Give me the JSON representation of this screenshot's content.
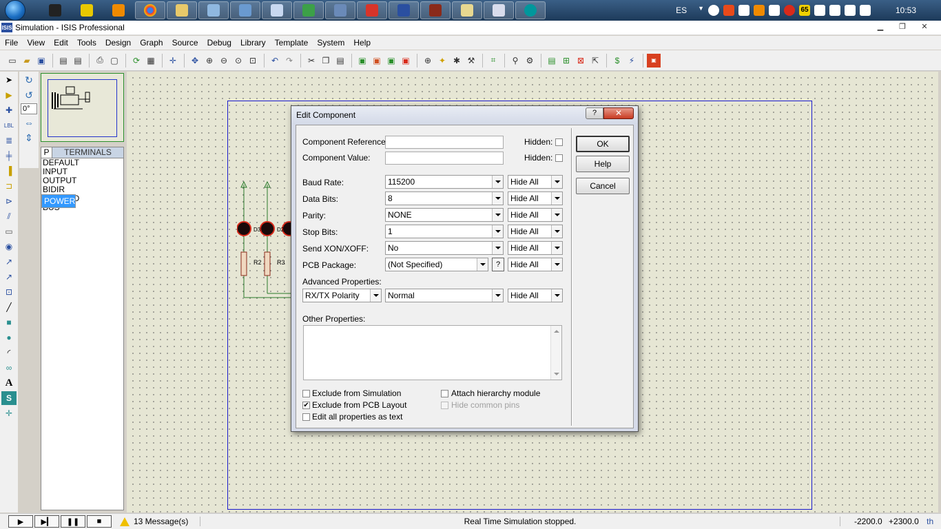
{
  "taskbar": {
    "apps": [
      {
        "name": "app-1"
      },
      {
        "name": "app-2"
      },
      {
        "name": "app-3"
      },
      {
        "name": "chrome"
      },
      {
        "name": "explorer"
      },
      {
        "name": "app-6"
      },
      {
        "name": "app-7"
      },
      {
        "name": "app-8"
      },
      {
        "name": "app-9"
      },
      {
        "name": "app-10"
      },
      {
        "name": "app-11"
      },
      {
        "name": "isis"
      },
      {
        "name": "app-13"
      },
      {
        "name": "app-14"
      },
      {
        "name": "app-15"
      },
      {
        "name": "arduino"
      }
    ],
    "language": "ES",
    "badge": "65",
    "clock": "10:53"
  },
  "window": {
    "app_icon": "ISIS",
    "title": "Simulation - ISIS Professional"
  },
  "menu": [
    "File",
    "View",
    "Edit",
    "Tools",
    "Design",
    "Graph",
    "Source",
    "Debug",
    "Library",
    "Template",
    "System",
    "Help"
  ],
  "rotation": "0°",
  "terminals": {
    "tab_p": "P",
    "header": "TERMINALS",
    "items": [
      "DEFAULT",
      "INPUT",
      "OUTPUT",
      "BIDIR",
      "POWER",
      "GROUND",
      "BUS"
    ],
    "selected": "POWER"
  },
  "dialog": {
    "title": "Edit Component",
    "help_glyph": "?",
    "close_glyph": "✕",
    "labels": {
      "component_reference": "Component Reference:",
      "component_value": "Component Value:",
      "hidden": "Hidden:",
      "baud_rate": "Baud Rate:",
      "data_bits": "Data Bits:",
      "parity": "Parity:",
      "stop_bits": "Stop Bits:",
      "send_xon": "Send XON/XOFF:",
      "pcb_package": "PCB Package:",
      "advanced": "Advanced Properties:",
      "other": "Other Properties:"
    },
    "values": {
      "component_reference": "",
      "component_value": "",
      "baud_rate": "115200",
      "data_bits": "8",
      "parity": "NONE",
      "stop_bits": "1",
      "send_xon": "No",
      "pcb_package": "(Not Specified)",
      "advanced_property": "RX/TX Polarity",
      "advanced_value": "Normal",
      "hide": "Hide All"
    },
    "checkboxes": {
      "exclude_sim": {
        "label": "Exclude from Simulation",
        "checked": false
      },
      "exclude_pcb": {
        "label": "Exclude from PCB Layout",
        "checked": true
      },
      "edit_all": {
        "label": "Edit all properties as text",
        "checked": false
      },
      "attach_hierarchy": {
        "label": "Attach hierarchy module",
        "checked": false
      },
      "hide_common": {
        "label": "Hide common pins",
        "checked": false,
        "disabled": true
      }
    },
    "buttons": {
      "ok": "OK",
      "help": "Help",
      "cancel": "Cancel"
    },
    "check_glyph": "✔",
    "pcb_help_glyph": "?"
  },
  "status": {
    "messages": "13 Message(s)",
    "text": "Real Time Simulation stopped.",
    "x": "-2200.0",
    "y": "+2300.0",
    "units": "th"
  }
}
